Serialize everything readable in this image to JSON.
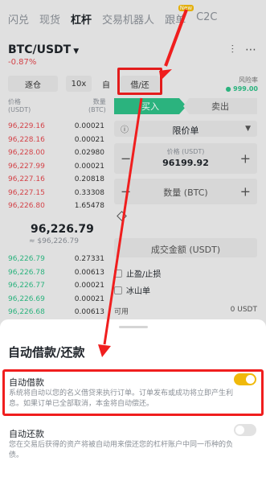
{
  "tabs": [
    "闪兑",
    "现货",
    "杠杆",
    "交易机器人",
    "跟单",
    "C2C"
  ],
  "tab_badge": "New",
  "pair": {
    "name": "BTC/USDT",
    "change": "-0.87%"
  },
  "controls": {
    "mode": "逐仓",
    "leverage": "10x",
    "auto": "自",
    "borrow_repay": "借/还"
  },
  "risk": {
    "label": "风险率",
    "value": "999.00"
  },
  "orderbook": {
    "price_header": "价格\n(USDT)",
    "qty_header": "数量\n(BTC)",
    "asks": [
      [
        "96,229.16",
        "0.00021"
      ],
      [
        "96,228.16",
        "0.00021"
      ],
      [
        "96,228.00",
        "0.02980"
      ],
      [
        "96,227.99",
        "0.00021"
      ],
      [
        "96,227.16",
        "0.20818"
      ],
      [
        "96,227.15",
        "0.33308"
      ],
      [
        "96,226.80",
        "1.65478"
      ]
    ],
    "last_price": "96,226.79",
    "last_price_sub": "≈ $96,226.79",
    "bids": [
      [
        "96,226.79",
        "0.27331"
      ],
      [
        "96,226.78",
        "0.00613"
      ],
      [
        "96,226.77",
        "0.00021"
      ],
      [
        "96,226.69",
        "0.00021"
      ],
      [
        "96,226.68",
        "0.00613"
      ]
    ]
  },
  "form": {
    "buy": "买入",
    "sell": "卖出",
    "order_type": "限价单",
    "price_label": "价格 (USDT)",
    "price_value": "96199.92",
    "qty_label": "数量 (BTC)",
    "total_label": "成交金额 (USDT)",
    "tpsl": "止盈/止损",
    "iceberg": "冰山单",
    "avail_label": "可用",
    "avail_value": "0 USDT"
  },
  "sheet": {
    "title": "自动借款/还款",
    "auto_borrow_title": "自动借款",
    "auto_borrow_desc": "系统将自动以您的名义借贷来执行订单。订单发布或成功将立即产生利息。如果订单已全部取消，本金将自动偿还。",
    "auto_borrow_on": true,
    "auto_repay_title": "自动还款",
    "auto_repay_desc": "您在交易后获得的资产将被自动用来偿还您的杠杆账户中同一币种的负债。",
    "auto_repay_on": false
  },
  "colors": {
    "accent": "#f0b90b",
    "buy": "#2ebd85",
    "sell": "#e0484e",
    "highlight": "#f01e1e"
  }
}
